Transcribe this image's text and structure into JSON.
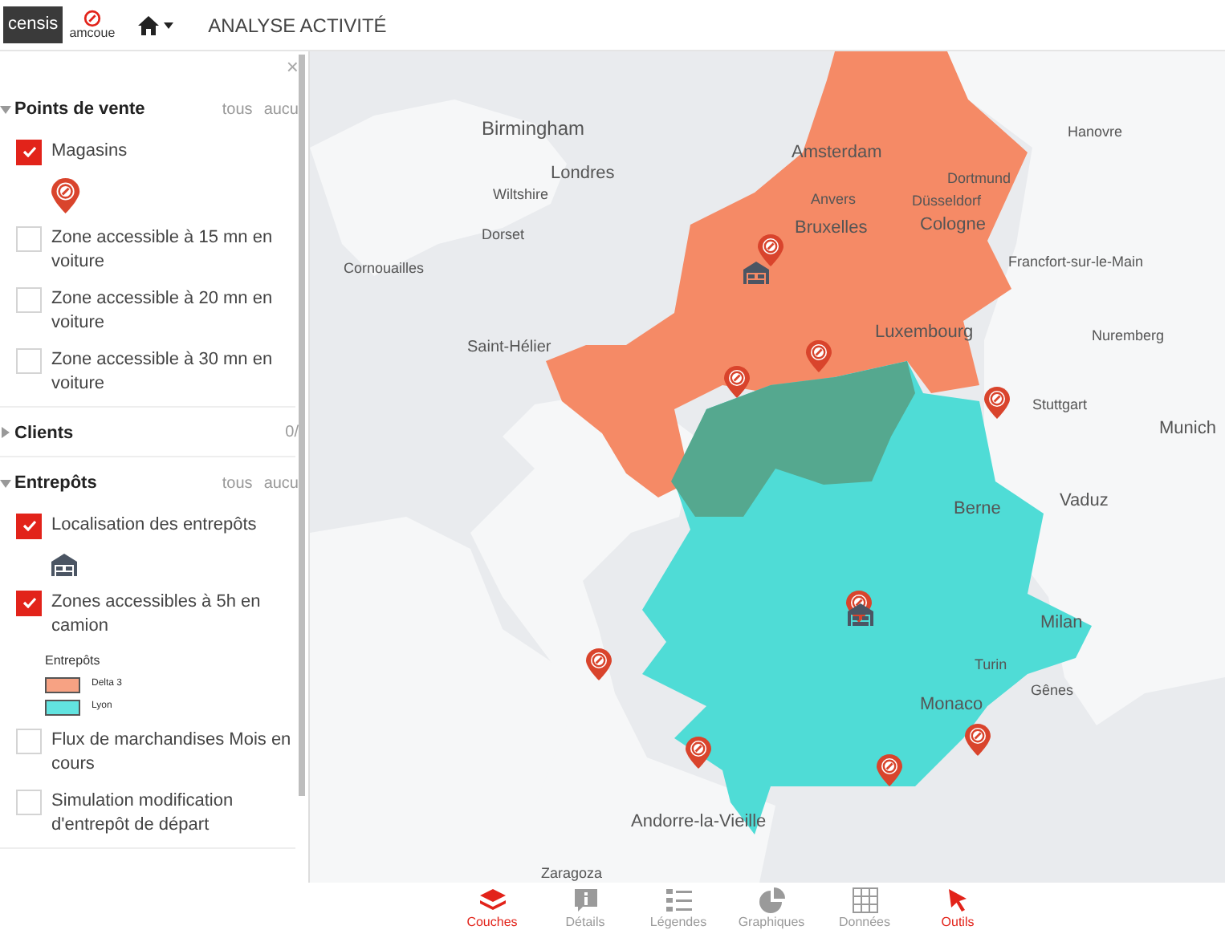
{
  "header": {
    "logo_text": "censis",
    "partner_logo": "amcoue",
    "title": "ANALYSE ACTIVITÉ"
  },
  "sidebar": {
    "close": "×",
    "sections": [
      {
        "title": "Points de vente",
        "expanded": true,
        "actions": [
          "tous",
          "aucu"
        ],
        "items": [
          {
            "label": "Magasins",
            "checked": true,
            "kind": "pin"
          },
          {
            "label": "Zone accessible à 15 mn en voiture",
            "checked": false,
            "kind": "plain"
          },
          {
            "label": "Zone accessible à 20 mn en voiture",
            "checked": false,
            "kind": "plain"
          },
          {
            "label": "Zone accessible à 30 mn en voiture",
            "checked": false,
            "kind": "plain"
          }
        ]
      },
      {
        "title": "Clients",
        "expanded": false,
        "count": "0/"
      },
      {
        "title": "Entrepôts",
        "expanded": true,
        "actions": [
          "tous",
          "aucu"
        ],
        "items": [
          {
            "label": "Localisation des entrepôts",
            "checked": true,
            "kind": "warehouse"
          },
          {
            "label": "Zones accessibles à 5h en camion",
            "checked": true,
            "kind": "legend",
            "legend": {
              "title": "Entrepôts",
              "entries": [
                {
                  "label": "Delta 3",
                  "color": "#f7a283"
                },
                {
                  "label": "Lyon",
                  "color": "#62e3e0"
                }
              ]
            }
          },
          {
            "label": "Flux de marchandises Mois en cours",
            "checked": false,
            "kind": "plain"
          },
          {
            "label": "Simulation modification d'entrepôt de départ",
            "checked": false,
            "kind": "plain"
          }
        ]
      }
    ]
  },
  "map": {
    "labels": [
      "Birmingham",
      "Londres",
      "Wiltshire",
      "Dorset",
      "Cornouailles",
      "Saint-Hélier",
      "Amsterdam",
      "Anvers",
      "Bruxelles",
      "Dortmund",
      "Düsseldorf",
      "Cologne",
      "Luxembourg",
      "Hanovre",
      "Francfort-sur-le-Main",
      "Nuremberg",
      "Stuttgart",
      "Munich",
      "Vaduz",
      "Berne",
      "Milan",
      "Turin",
      "Gênes",
      "Monaco",
      "Andorre-la-Vieille",
      "Zaragoza"
    ]
  },
  "toolbar": [
    {
      "label": "Couches",
      "selected": true,
      "kind": "layers"
    },
    {
      "label": "Détails",
      "selected": false,
      "kind": "info"
    },
    {
      "label": "Légendes",
      "selected": false,
      "kind": "list"
    },
    {
      "label": "Graphiques",
      "selected": false,
      "kind": "pie"
    },
    {
      "label": "Données",
      "selected": false,
      "kind": "grid"
    },
    {
      "label": "Outils",
      "selected": true,
      "kind": "cursor"
    }
  ]
}
